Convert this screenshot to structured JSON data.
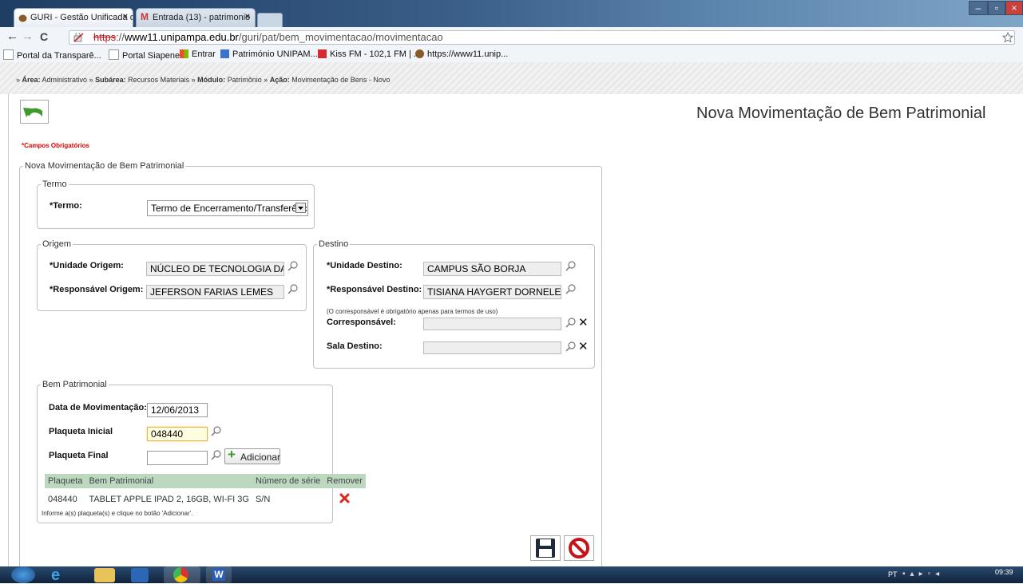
{
  "browser": {
    "tabs": [
      {
        "title": "GURI - Gestão Unificada d",
        "close": "×"
      },
      {
        "title": "Entrada (13) - patrimonio",
        "close": "×"
      }
    ],
    "window_buttons": {
      "minimize": "–",
      "maximize": "▫",
      "close": "×"
    },
    "nav": {
      "back": "←",
      "forward": "→",
      "reload": "C"
    },
    "url": {
      "scheme": "https",
      "scheme_rest": "://",
      "domain": "www11.unipampa.edu.br",
      "path": "/guri/pat/bem_movimentacao/movimentacao"
    },
    "bookmarks": [
      "Portal da Transparê...",
      "Portal Siapenet",
      "Entrar",
      "Património UNIPAM...",
      "Kiss FM - 102,1 FM | ...",
      "https://www11.unip..."
    ]
  },
  "breadcrumb": {
    "prefix": "» ",
    "area_label": "Área:",
    "area": "Administrativo",
    "subarea_label": "Subárea:",
    "subarea": "Recursos Materiais",
    "module_label": "Módulo:",
    "module": "Patrimônio",
    "action_label": "Ação:",
    "action": "Movimentação de Bens - Novo",
    "sep": " » "
  },
  "page": {
    "title": "Nova Movimentação de Bem Patrimonial",
    "required_note": "*Campos Obrigatórios",
    "main_legend": "Nova Movimentação de Bem Patrimonial"
  },
  "termo": {
    "legend": "Termo",
    "label": "*Termo:",
    "selected": "Termo de Encerramento/Transferência"
  },
  "origem": {
    "legend": "Origem",
    "unidade_label": "*Unidade Origem:",
    "unidade_value": "NÚCLEO DE TECNOLOGIA DA INF",
    "responsavel_label": "*Responsável Origem:",
    "responsavel_value": "JEFERSON FARIAS LEMES"
  },
  "destino": {
    "legend": "Destino",
    "unidade_label": "*Unidade Destino:",
    "unidade_value": "CAMPUS SÃO BORJA",
    "responsavel_label": "*Responsável Destino:",
    "responsavel_value": "TISIANA HAYGERT DORNELES",
    "corresponsavel_note": "(O corresponsável é obrigatório apenas para termos de uso)",
    "corresponsavel_label": "Corresponsável:",
    "corresponsavel_value": "",
    "sala_label": "Sala Destino:",
    "sala_value": ""
  },
  "bem": {
    "legend": "Bem Patrimonial",
    "data_label": "Data de Movimentação:",
    "data_value": "12/06/2013",
    "plaqueta_inicial_label": "Plaqueta Inicial",
    "plaqueta_inicial_value": "048440",
    "plaqueta_final_label": "Plaqueta Final",
    "plaqueta_final_value": "",
    "add_button": "Adicionar",
    "table": {
      "headers": [
        "Plaqueta",
        "Bem Patrimonial",
        "Número de série",
        "Remover"
      ],
      "rows": [
        {
          "plaqueta": "048440",
          "bem": "TABLET APPLE IPAD 2, 16GB, WI-FI 3G",
          "serie": "S/N"
        }
      ]
    },
    "hint": "Informe a(s) plaqueta(s) e clique no botão 'Adicionar'."
  },
  "taskbar": {
    "lang": "PT",
    "time": "09:39"
  },
  "colors": {
    "required_red": "#e00000",
    "table_header_green": "#bcd8bf",
    "back_button_green": "#3f9a2c"
  }
}
